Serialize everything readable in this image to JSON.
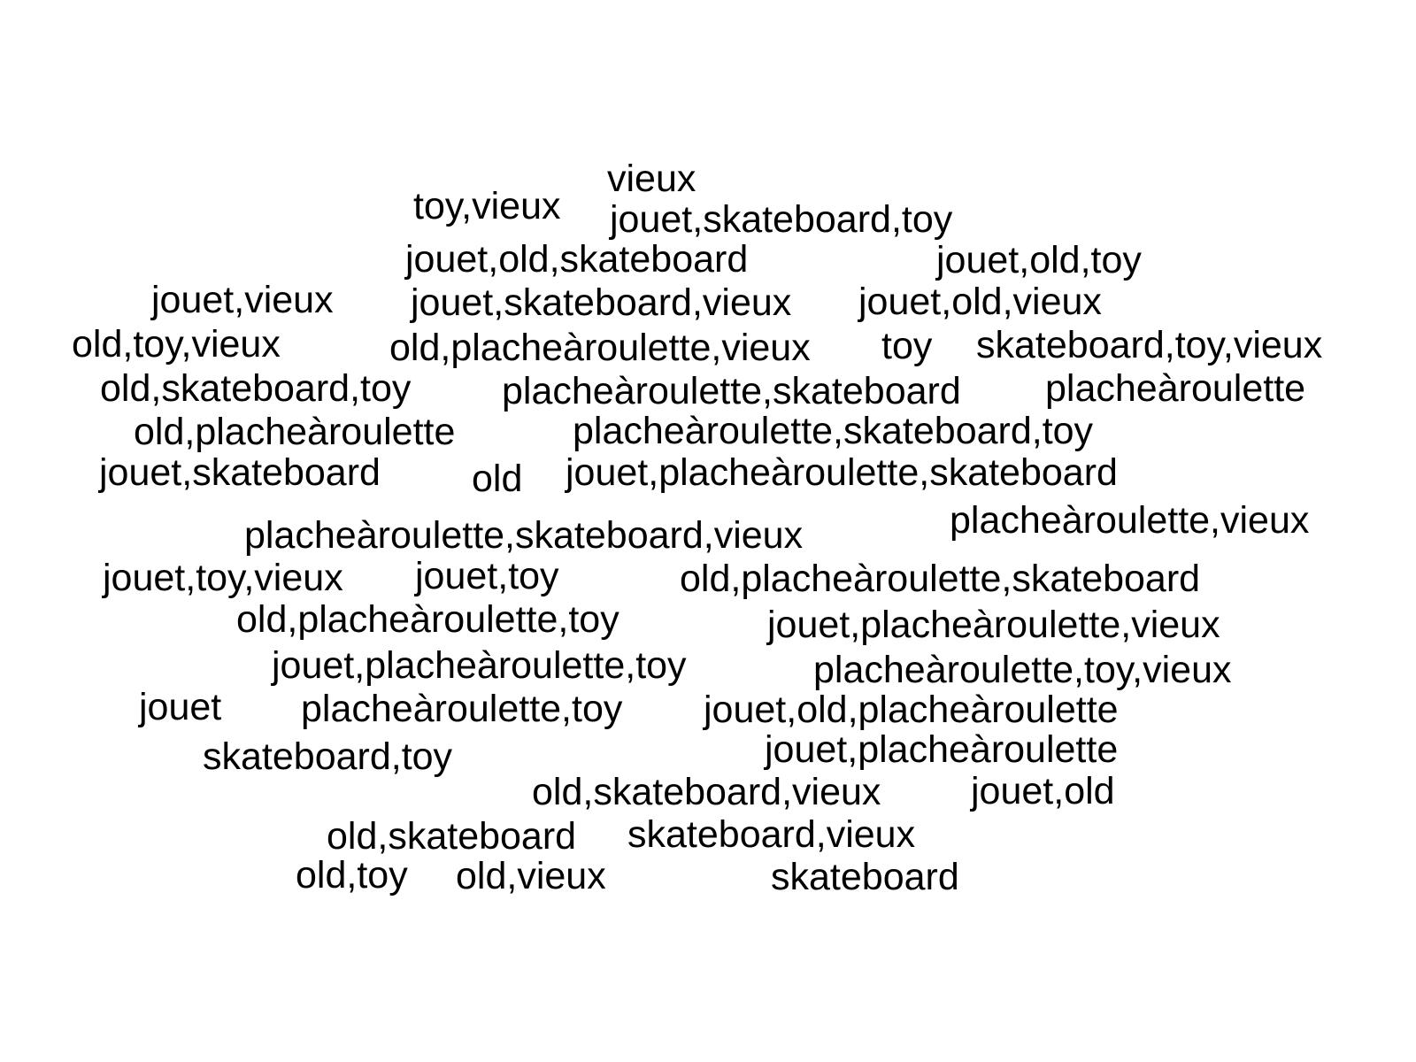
{
  "text_color": "#000000",
  "background_color": "#ffffff",
  "words": [
    "vieux",
    "toy,vieux",
    "jouet,skateboard,toy",
    "jouet,old,skateboard",
    "jouet,old,toy",
    "jouet,vieux",
    "jouet,skateboard,vieux",
    "jouet,old,vieux",
    "old,toy,vieux",
    "old,placheàroulette,vieux",
    "toy",
    "skateboard,toy,vieux",
    "old,skateboard,toy",
    "placheàroulette,skateboard",
    "placheàroulette",
    "old,placheàroulette",
    "placheàroulette,skateboard,toy",
    "jouet,skateboard",
    "old",
    "jouet,placheàroulette,skateboard",
    "placheàroulette,vieux",
    "placheàroulette,skateboard,vieux",
    "jouet,toy,vieux",
    "jouet,toy",
    "old,placheàroulette,skateboard",
    "old,placheàroulette,toy",
    "jouet,placheàroulette,vieux",
    "jouet,placheàroulette,toy",
    "placheàroulette,toy,vieux",
    "jouet",
    "placheàroulette,toy",
    "jouet,old,placheàroulette",
    "jouet,placheàroulette",
    "skateboard,toy",
    "old,skateboard,vieux",
    "jouet,old",
    "old,skateboard",
    "skateboard,vieux",
    "old,toy",
    "old,vieux",
    "skateboard"
  ]
}
